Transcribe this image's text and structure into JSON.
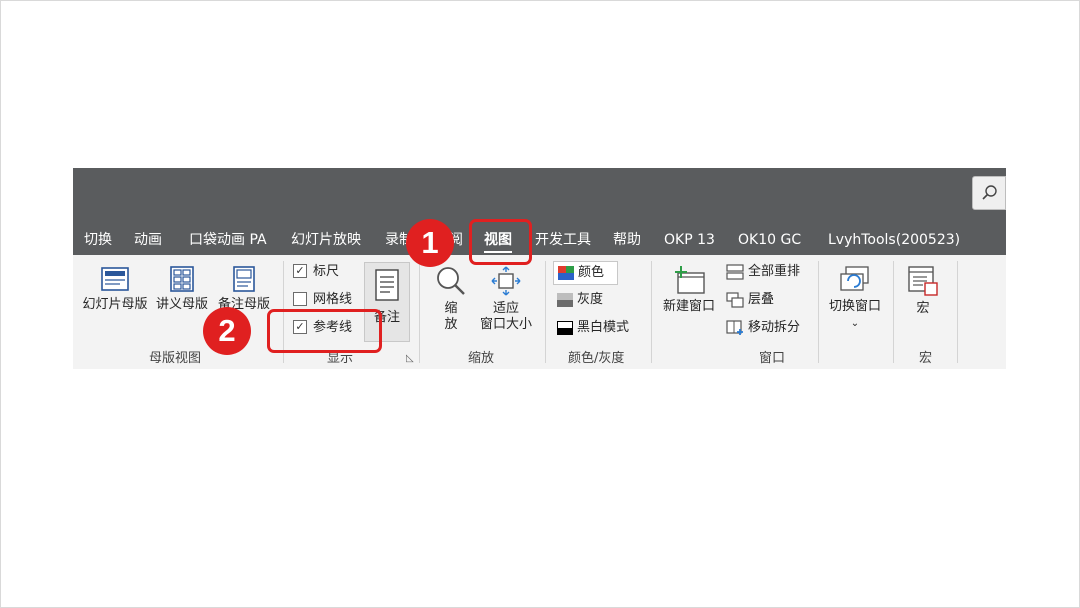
{
  "tabs": [
    {
      "label": "切换"
    },
    {
      "label": "动画"
    },
    {
      "label": "口袋动画 PA"
    },
    {
      "label": "幻灯片放映"
    },
    {
      "label": "录制"
    },
    {
      "label": "审阅"
    },
    {
      "label": "视图",
      "active": true
    },
    {
      "label": "开发工具"
    },
    {
      "label": "帮助"
    },
    {
      "label": "OKP 13"
    },
    {
      "label": "OK10 GC"
    },
    {
      "label": "LvyhTools(200523)"
    }
  ],
  "groups": {
    "master_views": {
      "label": "母版视图",
      "buttons": [
        "幻灯片母版",
        "讲义母版",
        "备注母版"
      ]
    },
    "show": {
      "label": "显示",
      "ruler": "标尺",
      "gridlines": "网格线",
      "guides": "参考线",
      "notes": "备注",
      "checked": {
        "ruler": true,
        "gridlines": false,
        "guides": true
      }
    },
    "zoom": {
      "label": "缩放",
      "zoom_line1": "缩",
      "zoom_line2": "放",
      "fit_line1": "适应",
      "fit_line2": "窗口大小"
    },
    "color": {
      "label": "颜色/灰度",
      "color": "颜色",
      "grayscale": "灰度",
      "bw": "黑白模式"
    },
    "window": {
      "label": "窗口",
      "new_window": "新建窗口",
      "arrange_all": "全部重排",
      "cascade": "层叠",
      "move_split": "移动拆分"
    },
    "switch": {
      "switch_windows": "切换窗口"
    },
    "macros": {
      "label": "宏",
      "macros": "宏"
    }
  },
  "annotations": {
    "badge1": "1",
    "badge2": "2"
  },
  "colors": {
    "titlebar": "#5a5c5e",
    "ribbon": "#f3f3f3",
    "highlight": "#e02020"
  }
}
